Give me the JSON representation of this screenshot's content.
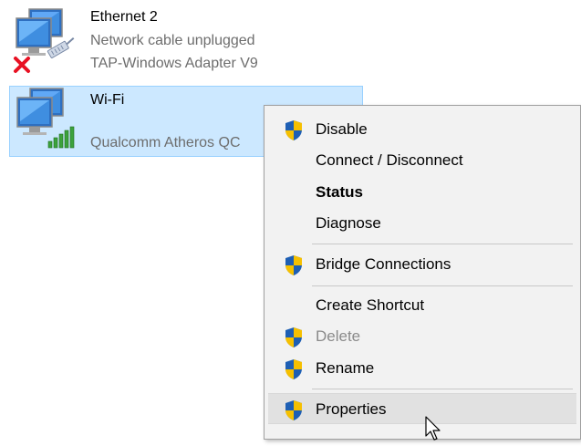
{
  "adapters": [
    {
      "name": "Ethernet 2",
      "status": "Network cable unplugged",
      "device": "TAP-Windows Adapter V9",
      "icon": "network-computer-icon",
      "badge": "red-x-icon",
      "selected": false
    },
    {
      "name": "Wi-Fi",
      "status": "",
      "device": "Qualcomm Atheros QC",
      "icon": "network-computer-icon",
      "badge": "signal-bars-icon",
      "selected": true
    }
  ],
  "context_menu": {
    "items": [
      {
        "label": "Disable",
        "shield": true,
        "bold": false,
        "disabled": false
      },
      {
        "label": "Connect / Disconnect",
        "shield": false,
        "bold": false,
        "disabled": false
      },
      {
        "label": "Status",
        "shield": false,
        "bold": true,
        "disabled": false
      },
      {
        "label": "Diagnose",
        "shield": false,
        "bold": false,
        "disabled": false
      },
      {
        "label": "Bridge Connections",
        "shield": true,
        "bold": false,
        "disabled": false
      },
      {
        "label": "Create Shortcut",
        "shield": false,
        "bold": false,
        "disabled": false
      },
      {
        "label": "Delete",
        "shield": true,
        "bold": false,
        "disabled": true
      },
      {
        "label": "Rename",
        "shield": true,
        "bold": false,
        "disabled": false
      },
      {
        "label": "Properties",
        "shield": true,
        "bold": false,
        "disabled": false,
        "hovered": true
      }
    ]
  },
  "colors": {
    "selection_bg": "#cce8ff",
    "selection_border": "#99d1ff",
    "menu_bg": "#f2f2f2",
    "menu_hover": "#e1e1e1",
    "secondary_text": "#6d6d6d",
    "disabled_text": "#8a8a8a",
    "shield_blue": "#1e5fb4",
    "shield_yellow": "#f6c000",
    "error_red": "#e81123",
    "signal_green": "#3ca23c"
  }
}
